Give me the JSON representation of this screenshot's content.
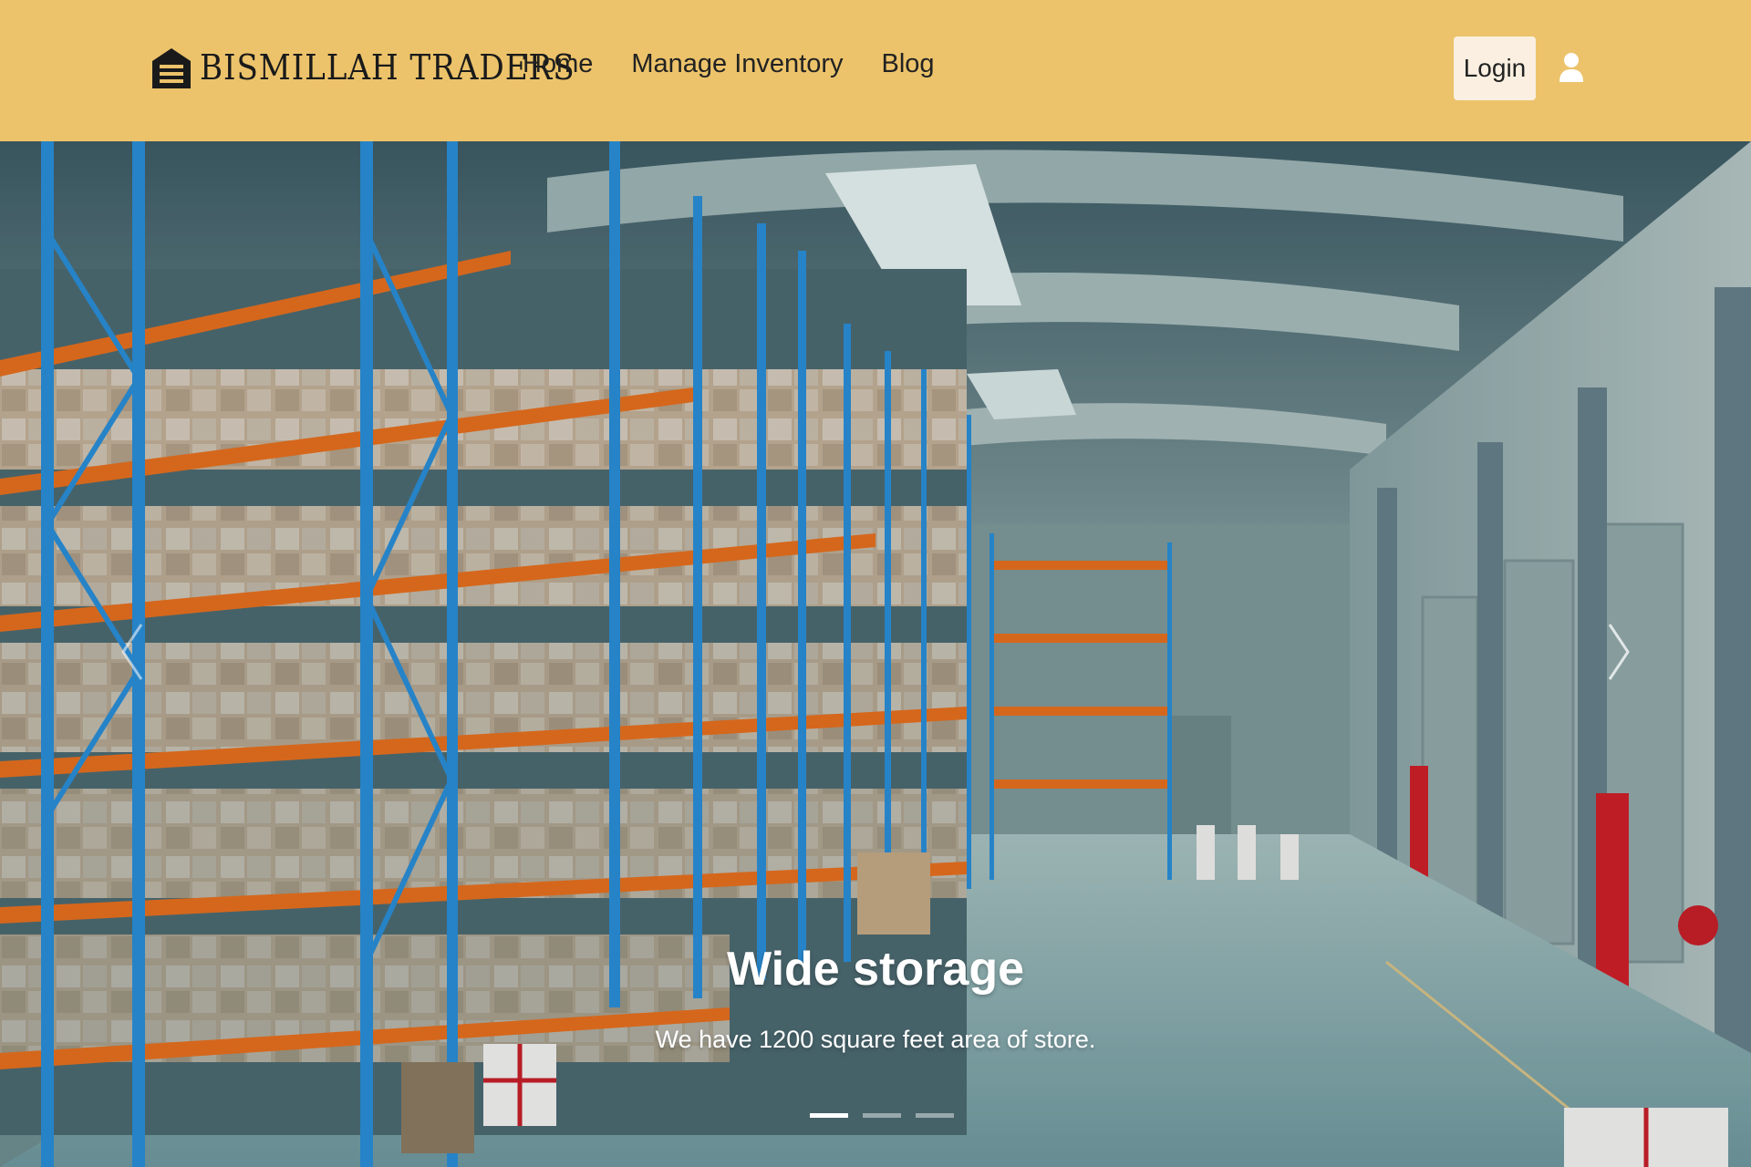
{
  "brand": {
    "name": "BISMILLAH TRADERS",
    "icon": "warehouse-icon"
  },
  "nav": {
    "items": [
      {
        "label": "Home"
      },
      {
        "label": "Manage Inventory"
      },
      {
        "label": "Blog"
      }
    ],
    "login_label": "Login",
    "user_icon": "user-icon"
  },
  "carousel": {
    "slide_title": "Wide storage",
    "slide_text": "We have 1200 square feet area of store.",
    "slide_count": 3,
    "active_slide": 1
  },
  "colors": {
    "navbar_bg": "#ecc36b",
    "login_bg": "#faefe1",
    "rack_blue": "#2a8fd8",
    "beam_orange": "#e8701f"
  }
}
